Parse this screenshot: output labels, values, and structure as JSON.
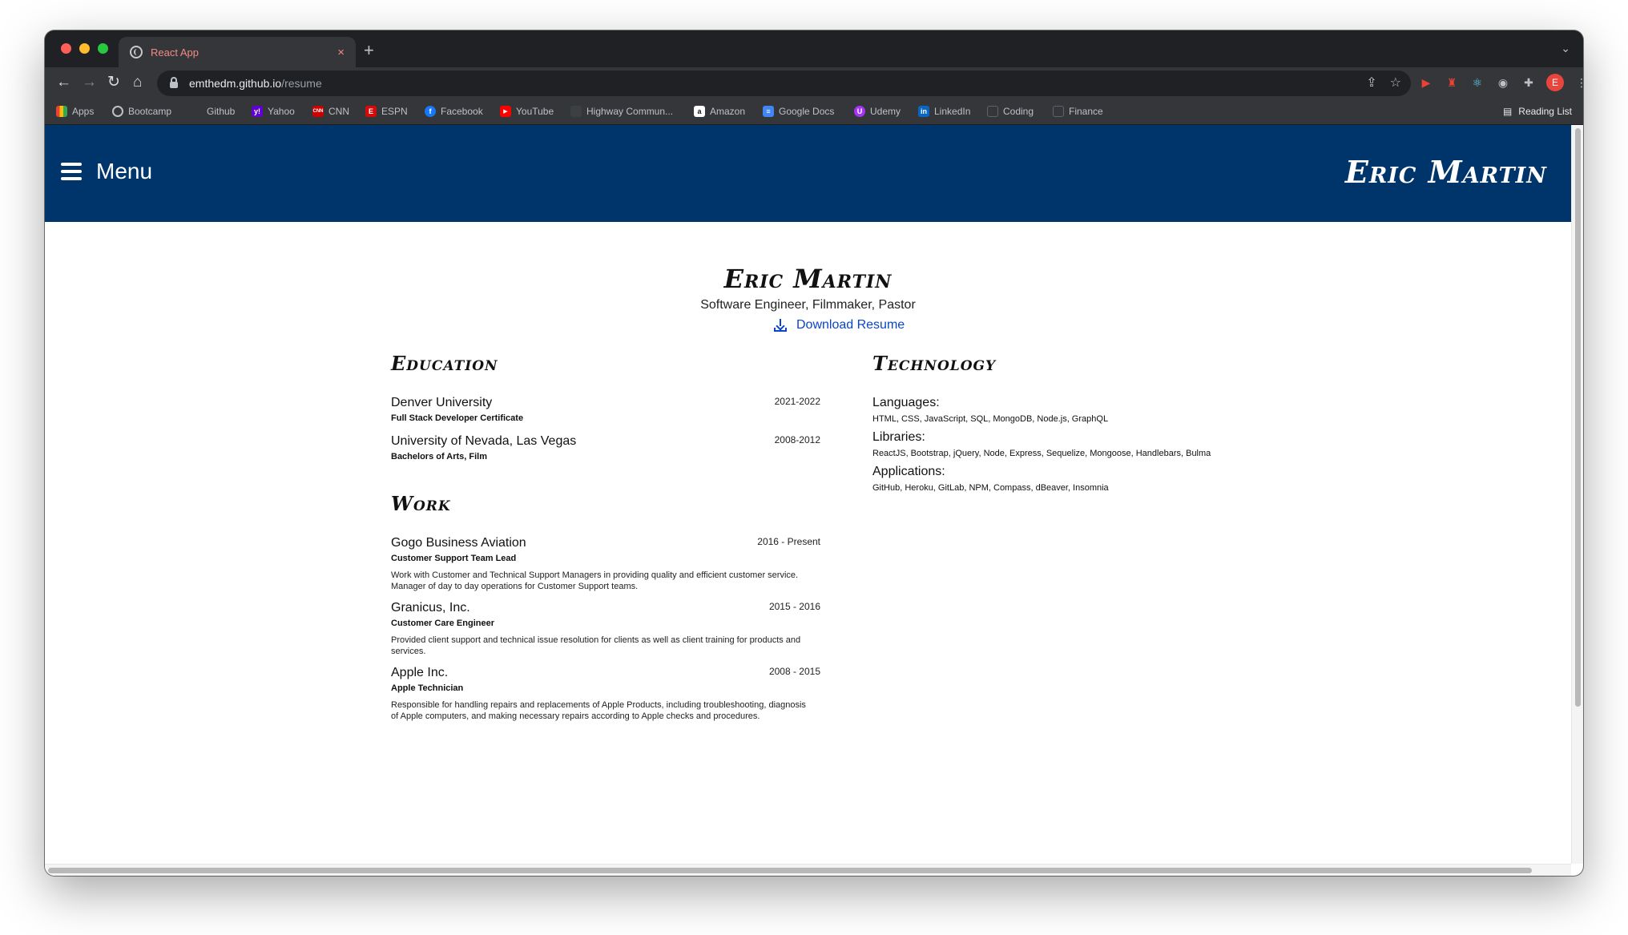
{
  "browser": {
    "tab_title": "React App",
    "tab_close": "×",
    "new_tab": "+",
    "tab_menu": "⌄",
    "url_host": "emthedm.github.io",
    "url_path": "/resume",
    "profile_initial": "E",
    "reading_list": "Reading List",
    "bookmarks": [
      {
        "label": "Apps",
        "icon": "apps-grid-icon",
        "color": "#4285f4"
      },
      {
        "label": "Bootcamp",
        "icon": "globe-icon",
        "color": "#9aa0a6"
      },
      {
        "label": "Github",
        "icon": "github-icon",
        "color": "#35363a"
      },
      {
        "label": "Yahoo",
        "icon": "yahoo-icon",
        "color": "#6001d2"
      },
      {
        "label": "CNN",
        "icon": "cnn-icon",
        "color": "#cc0000"
      },
      {
        "label": "ESPN",
        "icon": "espn-icon",
        "color": "#d50a0a"
      },
      {
        "label": "Facebook",
        "icon": "facebook-icon",
        "color": "#1877f2"
      },
      {
        "label": "YouTube",
        "icon": "youtube-icon",
        "color": "#ff0000"
      },
      {
        "label": "Highway Commun...",
        "icon": "highway-icon",
        "color": "#3c4043"
      },
      {
        "label": "Amazon",
        "icon": "amazon-icon",
        "color": "#ffffff"
      },
      {
        "label": "Google Docs",
        "icon": "google-docs-icon",
        "color": "#4285f4"
      },
      {
        "label": "Udemy",
        "icon": "udemy-icon",
        "color": "#a435f0"
      },
      {
        "label": "LinkedIn",
        "icon": "linkedin-icon",
        "color": "#0a66c2"
      },
      {
        "label": "Coding",
        "icon": "folder-icon",
        "color": "#5f6368"
      },
      {
        "label": "Finance",
        "icon": "folder-icon",
        "color": "#5f6368"
      }
    ]
  },
  "header": {
    "menu_label": "Menu",
    "brand": "Eric Martin",
    "background": "#00356b"
  },
  "resume": {
    "name": "Eric Martin",
    "subtitle": "Software Engineer, Filmmaker, Pastor",
    "download_label": "Download Resume",
    "education_title": "Education",
    "education": [
      {
        "school": "Denver University",
        "date": "2021-2022",
        "degree": "Full Stack Developer Certificate"
      },
      {
        "school": "University of Nevada, Las Vegas",
        "date": "2008-2012",
        "degree": "Bachelors of Arts, Film"
      }
    ],
    "work_title": "Work",
    "work": [
      {
        "company": "Gogo Business Aviation",
        "date": "2016 - Present",
        "role": "Customer Support Team Lead",
        "description": "Work with Customer and Technical Support Managers in providing quality and efficient customer service. Manager of day to day operations for Customer Support teams."
      },
      {
        "company": "Granicus, Inc.",
        "date": "2015 - 2016",
        "role": "Customer Care Engineer",
        "description": "Provided client support and technical issue resolution for clients as well as client training for products and services."
      },
      {
        "company": "Apple Inc.",
        "date": "2008 - 2015",
        "role": "Apple Technician",
        "description": "Responsible for handling repairs and replacements of Apple Products, including troubleshooting, diagnosis of Apple computers, and making necessary repairs according to Apple checks and procedures."
      }
    ],
    "technology_title": "Technology",
    "technology": [
      {
        "label": "Languages:",
        "items": "HTML, CSS, JavaScript, SQL, MongoDB, Node.js, GraphQL"
      },
      {
        "label": "Libraries:",
        "items": "ReactJS, Bootstrap, jQuery, Node, Express, Sequelize, Mongoose, Handlebars, Bulma"
      },
      {
        "label": "Applications:",
        "items": "GitHub, Heroku, GitLab, NPM, Compass, dBeaver, Insomnia"
      }
    ]
  }
}
